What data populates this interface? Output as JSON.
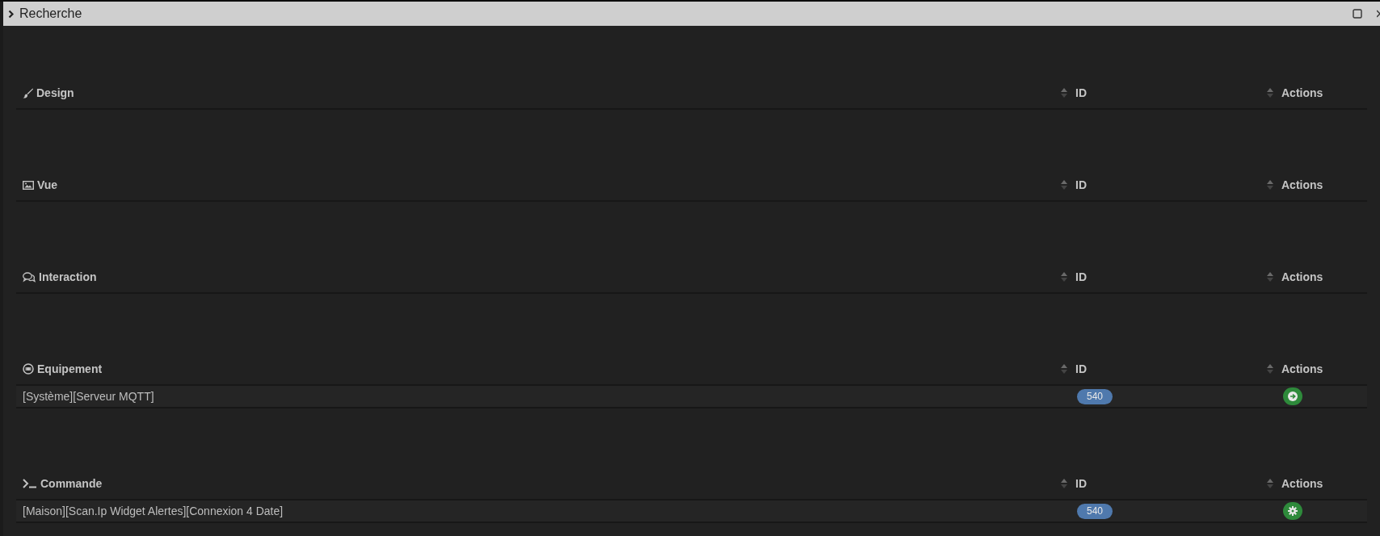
{
  "window": {
    "title": "Recherche"
  },
  "sections": [
    {
      "title": "Design",
      "kind": "brush",
      "columns": [
        "ID",
        "Actions"
      ]
    },
    {
      "title": "Vue",
      "kind": "picture",
      "columns": [
        "ID",
        "Actions"
      ]
    },
    {
      "title": "Interaction",
      "kind": "chat",
      "columns": [
        "ID",
        "Actions"
      ]
    },
    {
      "title": "Equipement",
      "kind": "equipment",
      "columns": [
        "ID",
        "Actions"
      ],
      "rows": [
        {
          "name": "[Système][Serveur MQTT]",
          "id": "540",
          "kind": "goto"
        }
      ]
    },
    {
      "title": "Commande",
      "kind": "terminal",
      "columns": [
        "ID",
        "Actions"
      ],
      "rows": [
        {
          "name": "[Maison][Scan.Ip Widget Alertes][Connexion 4 Date]",
          "id": "540",
          "kind": "configure"
        }
      ]
    }
  ]
}
